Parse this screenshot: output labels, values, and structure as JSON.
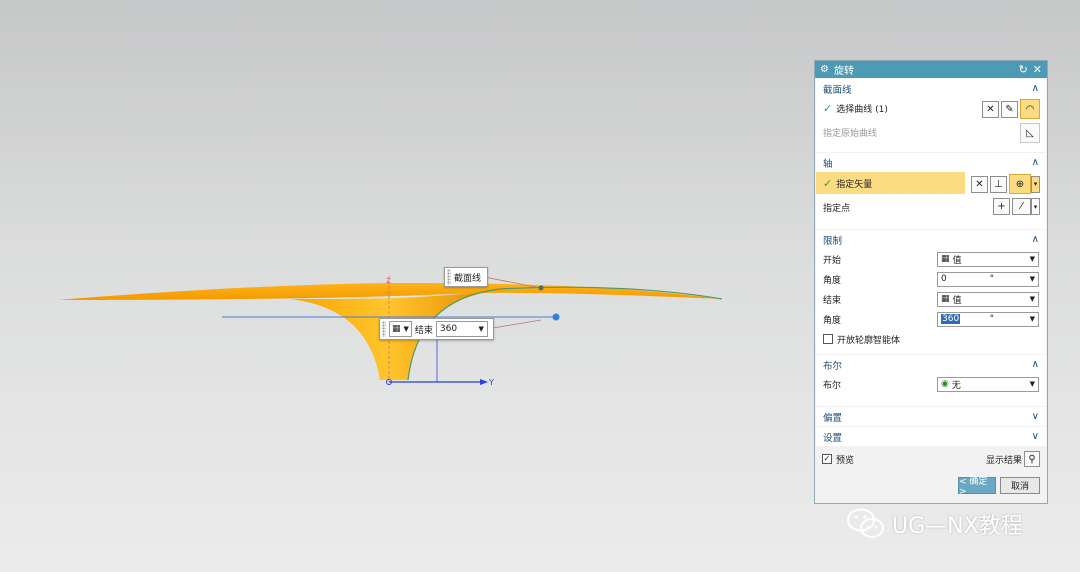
{
  "viewport": {
    "callout_section_label": "截面线",
    "callout_end_label": "结束",
    "callout_end_value": "360",
    "axis_y_label": "Y",
    "axis_z_label": "Z"
  },
  "dialog": {
    "title": "旋转",
    "sections": {
      "section_curve": {
        "title": "截面线",
        "select_curve_label": "选择曲线 (1)",
        "specify_origin_curve_label": "指定原始曲线"
      },
      "axis": {
        "title": "轴",
        "specify_vector_label": "指定矢量",
        "specify_point_label": "指定点"
      },
      "limits": {
        "title": "限制",
        "start_label": "开始",
        "start_mode": "值",
        "start_angle_label": "角度",
        "start_angle_value": "0",
        "end_label": "结束",
        "end_mode": "值",
        "end_angle_label": "角度",
        "end_angle_value": "360",
        "angle_unit": "°",
        "open_profile_label": "开放轮廓智能体"
      },
      "boolean": {
        "title": "布尔",
        "boolean_label": "布尔",
        "boolean_value": "无"
      },
      "offset": {
        "title": "偏置"
      },
      "settings": {
        "title": "设置"
      }
    },
    "preview_label": "预览",
    "show_result_label": "显示结果",
    "ok_label": "< 确定 >",
    "cancel_label": "取消"
  },
  "watermark": {
    "text": "UG—NX教程"
  },
  "colors": {
    "titlebar": "#4d9ab4",
    "highlight": "#fbdc83",
    "surface": "#f5a400",
    "section_title": "#1e4d78"
  }
}
